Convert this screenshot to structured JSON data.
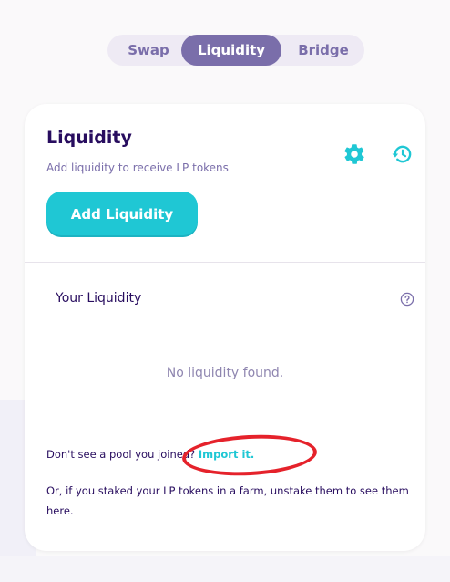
{
  "tabs": {
    "swap": "Swap",
    "liquidity": "Liquidity",
    "bridge": "Bridge",
    "active": "liquidity"
  },
  "card": {
    "title": "Liquidity",
    "subtitle": "Add liquidity to receive LP tokens",
    "add_button": "Add Liquidity",
    "settings_icon": "gear-icon",
    "history_icon": "history-icon"
  },
  "your_liquidity": {
    "heading": "Your Liquidity",
    "help_icon": "question-circle-icon",
    "empty_text": "No liquidity found."
  },
  "import": {
    "prompt": "Don't see a pool you joined?",
    "link": "Import it."
  },
  "staked_note": "Or, if you staked your LP tokens in a farm, unstake them to see them here.",
  "colors": {
    "primary": "#1fc7d4",
    "secondary": "#7a6eaa",
    "text": "#280d5f",
    "annotation": "#e5222b"
  }
}
